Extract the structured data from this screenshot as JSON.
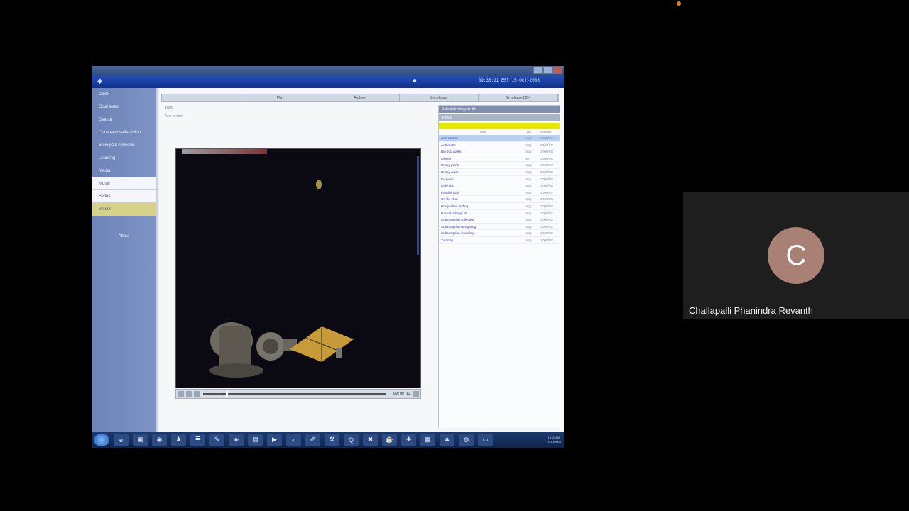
{
  "meeting": {
    "participant": {
      "initial": "C",
      "name": "Challapalli Phanindra Revanth",
      "avatar_color": "#a98074"
    },
    "recording_color": "#e07a1c"
  },
  "shared_app": {
    "header": {
      "clock": "09:36:21 EST 15-Oct-2008"
    },
    "sidebar": {
      "items": [
        {
          "label": "Clock",
          "style": "normal"
        },
        {
          "label": "Goal trees",
          "style": "normal"
        },
        {
          "label": "Search",
          "style": "normal"
        },
        {
          "label": "Constraint satisfaction",
          "style": "normal"
        },
        {
          "label": "Biological networks",
          "style": "normal"
        },
        {
          "label": "Learning",
          "style": "normal"
        },
        {
          "label": "Media",
          "style": "normal"
        },
        {
          "label": "Music",
          "style": "white"
        },
        {
          "label": "Slides",
          "style": "white"
        },
        {
          "label": "Videos",
          "style": "yellow"
        }
      ],
      "about": "About"
    },
    "tabs": [
      "",
      "Play",
      "Archive",
      "By release",
      "By release DC4"
    ],
    "topic_label": "Topic",
    "topic_value": "Arm control",
    "video": {
      "time": "00:00:12"
    },
    "right_panel": {
      "header": "Select directory or file",
      "subheader": "Topics",
      "columns": [
        "Topic",
        "Type",
        "Modified"
      ],
      "rows": [
        {
          "topic": "Arm control",
          "type": "mpg",
          "modified": "2008/07",
          "selected": true
        },
        {
          "topic": "Arithmetic",
          "type": "mpg",
          "modified": "2008/07"
        },
        {
          "topic": "Big dog walks",
          "type": "mpg",
          "modified": "2008/06"
        },
        {
          "topic": "Cluster",
          "type": "avi",
          "modified": "2008/06"
        },
        {
          "topic": "DiGuy points",
          "type": "mpg",
          "modified": "2008/07"
        },
        {
          "topic": "DiGuy wave",
          "type": "mpg",
          "modified": "2008/02"
        },
        {
          "topic": "Evolution",
          "type": "mpg",
          "modified": "2008/06"
        },
        {
          "topic": "Little dog",
          "type": "mpg",
          "modified": "2008/06"
        },
        {
          "topic": "Parallel trials",
          "type": "mpg",
          "modified": "2008/07"
        },
        {
          "topic": "On the Run",
          "type": "mpg",
          "modified": "2008/06"
        },
        {
          "topic": "Pre-packed finding",
          "type": "mpg",
          "modified": "2008/06"
        },
        {
          "topic": "Racket voltage bit",
          "type": "mpg",
          "modified": "2008/07"
        },
        {
          "topic": "Subsumption collecting",
          "type": "mpg",
          "modified": "2008/02"
        },
        {
          "topic": "Subsumption navigating",
          "type": "mpg",
          "modified": "2008/02"
        },
        {
          "topic": "Subsumption modeling",
          "type": "mpg",
          "modified": "2008/02"
        },
        {
          "topic": "Tutoring",
          "type": "mpg",
          "modified": "2008/06"
        }
      ]
    },
    "taskbar": {
      "icons": [
        "ie-icon",
        "folder-icon",
        "media-icon",
        "figure-icon",
        "notepad-icon",
        "paint-icon",
        "app-icon",
        "drive-icon",
        "player-icon",
        "firefox-icon",
        "edit-icon",
        "tool-icon",
        "q-icon",
        "x-icon",
        "java-icon",
        "pin-icon",
        "device-icon",
        "figure2-icon",
        "globe-icon",
        "battery-icon"
      ],
      "time": "10:36 AM",
      "date": "10/15/2008"
    }
  }
}
